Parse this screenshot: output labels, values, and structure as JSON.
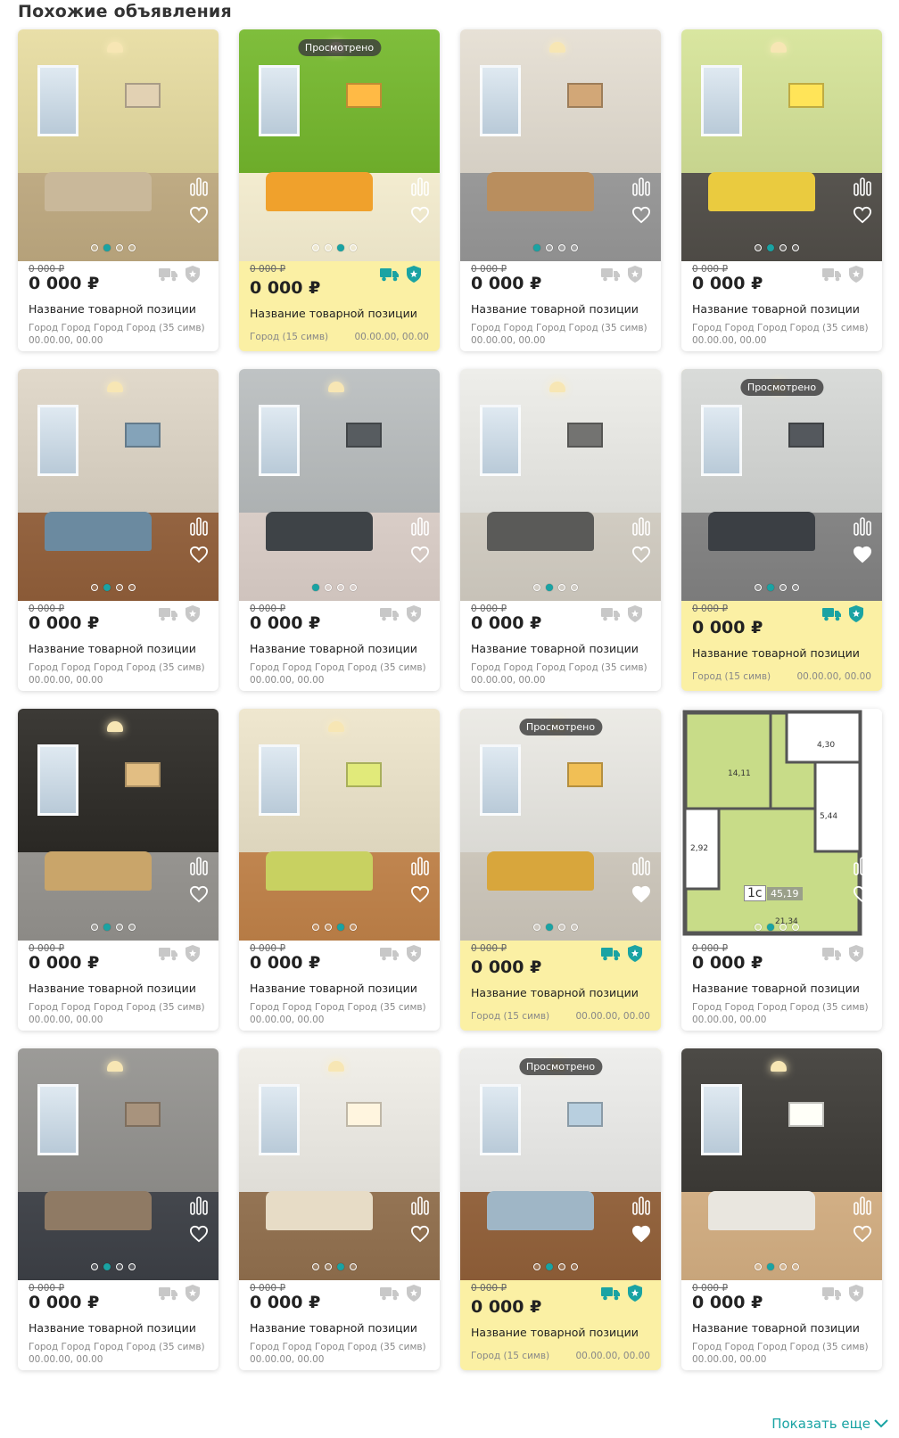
{
  "section_title": "Похожие объявления",
  "show_more": "Показать еще",
  "colors": {
    "accent": "#1aa3a3",
    "promo_bg": "#fbf0a4",
    "icon_gray": "#c8c8c8"
  },
  "cards": [
    {
      "viewed": "",
      "old_price": "0 000 ₽",
      "price": "0 000 ₽",
      "title": "Название товарной позиции",
      "city": "Город Город Город Город  (35 симв)",
      "date": "00.00.00, 00.00",
      "promo": false,
      "favorite": false,
      "active_dot": 1,
      "scene": [
        "#e9dfa8",
        "#c9b89a",
        "#b5a17a"
      ]
    },
    {
      "viewed": "Просмотрено",
      "old_price": "0 000 ₽",
      "price": "0 000 ₽",
      "title": "Название товарной позиции",
      "city": "Город (15 симв)",
      "date": "00.00.00, 00.00",
      "promo": true,
      "favorite": false,
      "active_dot": 2,
      "scene": [
        "#7fbe3c",
        "#f0a12c",
        "#e9e2c6"
      ]
    },
    {
      "viewed": "",
      "old_price": "0 000 ₽",
      "price": "0 000 ₽",
      "title": "Название товарной позиции",
      "city": "Город Город Город Город  (35 симв)",
      "date": "00.00.00, 00.00",
      "promo": false,
      "favorite": false,
      "active_dot": 0,
      "scene": [
        "#e7e1d6",
        "#b98e5e",
        "#8f8f8f"
      ]
    },
    {
      "viewed": "",
      "old_price": "0 000 ₽",
      "price": "0 000 ₽",
      "title": "Название товарной позиции",
      "city": "Город Город Город Город  (35 симв)",
      "date": "00.00.00, 00.00",
      "promo": false,
      "favorite": false,
      "active_dot": 1,
      "scene": [
        "#d9e6a0",
        "#eacb3f",
        "#4d4a45"
      ]
    },
    {
      "viewed": "",
      "old_price": "0 000 ₽",
      "price": "0 000 ₽",
      "title": "Название товарной позиции",
      "city": "Город Город Город Город  (35 симв)",
      "date": "00.00.00, 00.00",
      "promo": false,
      "favorite": false,
      "active_dot": 1,
      "scene": [
        "#e1d9cb",
        "#6b8aa0",
        "#8a5a37"
      ]
    },
    {
      "viewed": "",
      "old_price": "0 000 ₽",
      "price": "0 000 ₽",
      "title": "Название товарной позиции",
      "city": "Город Город Город Город  (35 симв)",
      "date": "00.00.00, 00.00",
      "promo": false,
      "favorite": false,
      "active_dot": 0,
      "scene": [
        "#bfc3c4",
        "#3e4347",
        "#cfc3bd"
      ]
    },
    {
      "viewed": "",
      "old_price": "0 000 ₽",
      "price": "0 000 ₽",
      "title": "Название товарной позиции",
      "city": "Город Город Город Город  (35 симв)",
      "date": "00.00.00, 00.00",
      "promo": false,
      "favorite": false,
      "active_dot": 1,
      "scene": [
        "#eeeeea",
        "#5a5a58",
        "#c7c2b8"
      ]
    },
    {
      "viewed": "Просмотрено",
      "old_price": "0 000 ₽",
      "price": "0 000 ₽",
      "title": "Название товарной позиции",
      "city": "Город (15 симв)",
      "date": "00.00.00, 00.00",
      "promo": true,
      "favorite": true,
      "active_dot": 1,
      "scene": [
        "#d9dbd9",
        "#3b3f44",
        "#7b7b7b"
      ]
    },
    {
      "viewed": "",
      "old_price": "0 000 ₽",
      "price": "0 000 ₽",
      "title": "Название товарной позиции",
      "city": "Город Город Город Город  (35 симв)",
      "date": "00.00.00, 00.00",
      "promo": false,
      "favorite": false,
      "active_dot": 1,
      "scene": [
        "#3c3a36",
        "#c9a56a",
        "#8c8a86"
      ]
    },
    {
      "viewed": "",
      "old_price": "0 000 ₽",
      "price": "0 000 ₽",
      "title": "Название товарной позиции",
      "city": "Город Город Город Город  (35 симв)",
      "date": "00.00.00, 00.00",
      "promo": false,
      "favorite": false,
      "active_dot": 2,
      "scene": [
        "#efe7cf",
        "#c8d161",
        "#b67b45"
      ]
    },
    {
      "viewed": "Просмотрено",
      "old_price": "0 000 ₽",
      "price": "0 000 ₽",
      "title": "Название товарной позиции",
      "city": "Город (15 симв)",
      "date": "00.00.00, 00.00",
      "promo": true,
      "favorite": true,
      "active_dot": 1,
      "scene": [
        "#ecebe6",
        "#d8a63c",
        "#c2bcb1"
      ]
    },
    {
      "viewed": "",
      "old_price": "0 000 ₽",
      "price": "0 000 ₽",
      "title": "Название товарной позиции",
      "city": "Город Город Город Город  (35 симв)",
      "date": "00.00.00, 00.00",
      "promo": false,
      "favorite": false,
      "active_dot": 1,
      "scene": [
        "#c7d98b",
        "#ffffff",
        "#6a6a6a"
      ],
      "floorplan": {
        "rooms": [
          "14,11",
          "4,30",
          "5,44",
          "2,92",
          "45,19",
          "21,34"
        ],
        "type": "1с"
      }
    },
    {
      "viewed": "",
      "old_price": "0 000 ₽",
      "price": "0 000 ₽",
      "title": "Название товарной позиции",
      "city": "Город Город Город Город  (35 симв)",
      "date": "00.00.00, 00.00",
      "promo": false,
      "favorite": false,
      "active_dot": 1,
      "scene": [
        "#9c9b98",
        "#8f7a64",
        "#3a3d43"
      ]
    },
    {
      "viewed": "",
      "old_price": "0 000 ₽",
      "price": "0 000 ₽",
      "title": "Название товарной позиции",
      "city": "Город Город Город Город  (35 симв)",
      "date": "00.00.00, 00.00",
      "promo": false,
      "favorite": false,
      "active_dot": 2,
      "scene": [
        "#f1efe9",
        "#e7dcc6",
        "#8a6a4a"
      ]
    },
    {
      "viewed": "Просмотрено",
      "old_price": "0 000 ₽",
      "price": "0 000 ₽",
      "title": "Название товарной позиции",
      "city": "Город (15 симв)",
      "date": "00.00.00, 00.00",
      "promo": true,
      "favorite": true,
      "active_dot": 1,
      "scene": [
        "#eeeeec",
        "#9fb6c6",
        "#8a5b36"
      ]
    },
    {
      "viewed": "",
      "old_price": "0 000 ₽",
      "price": "0 000 ₽",
      "title": "Название товарной позиции",
      "city": "Город Город Город Город  (35 симв)",
      "date": "00.00.00, 00.00",
      "promo": false,
      "favorite": false,
      "active_dot": 1,
      "scene": [
        "#4c4a46",
        "#e9e6df",
        "#c8a57b"
      ]
    }
  ]
}
